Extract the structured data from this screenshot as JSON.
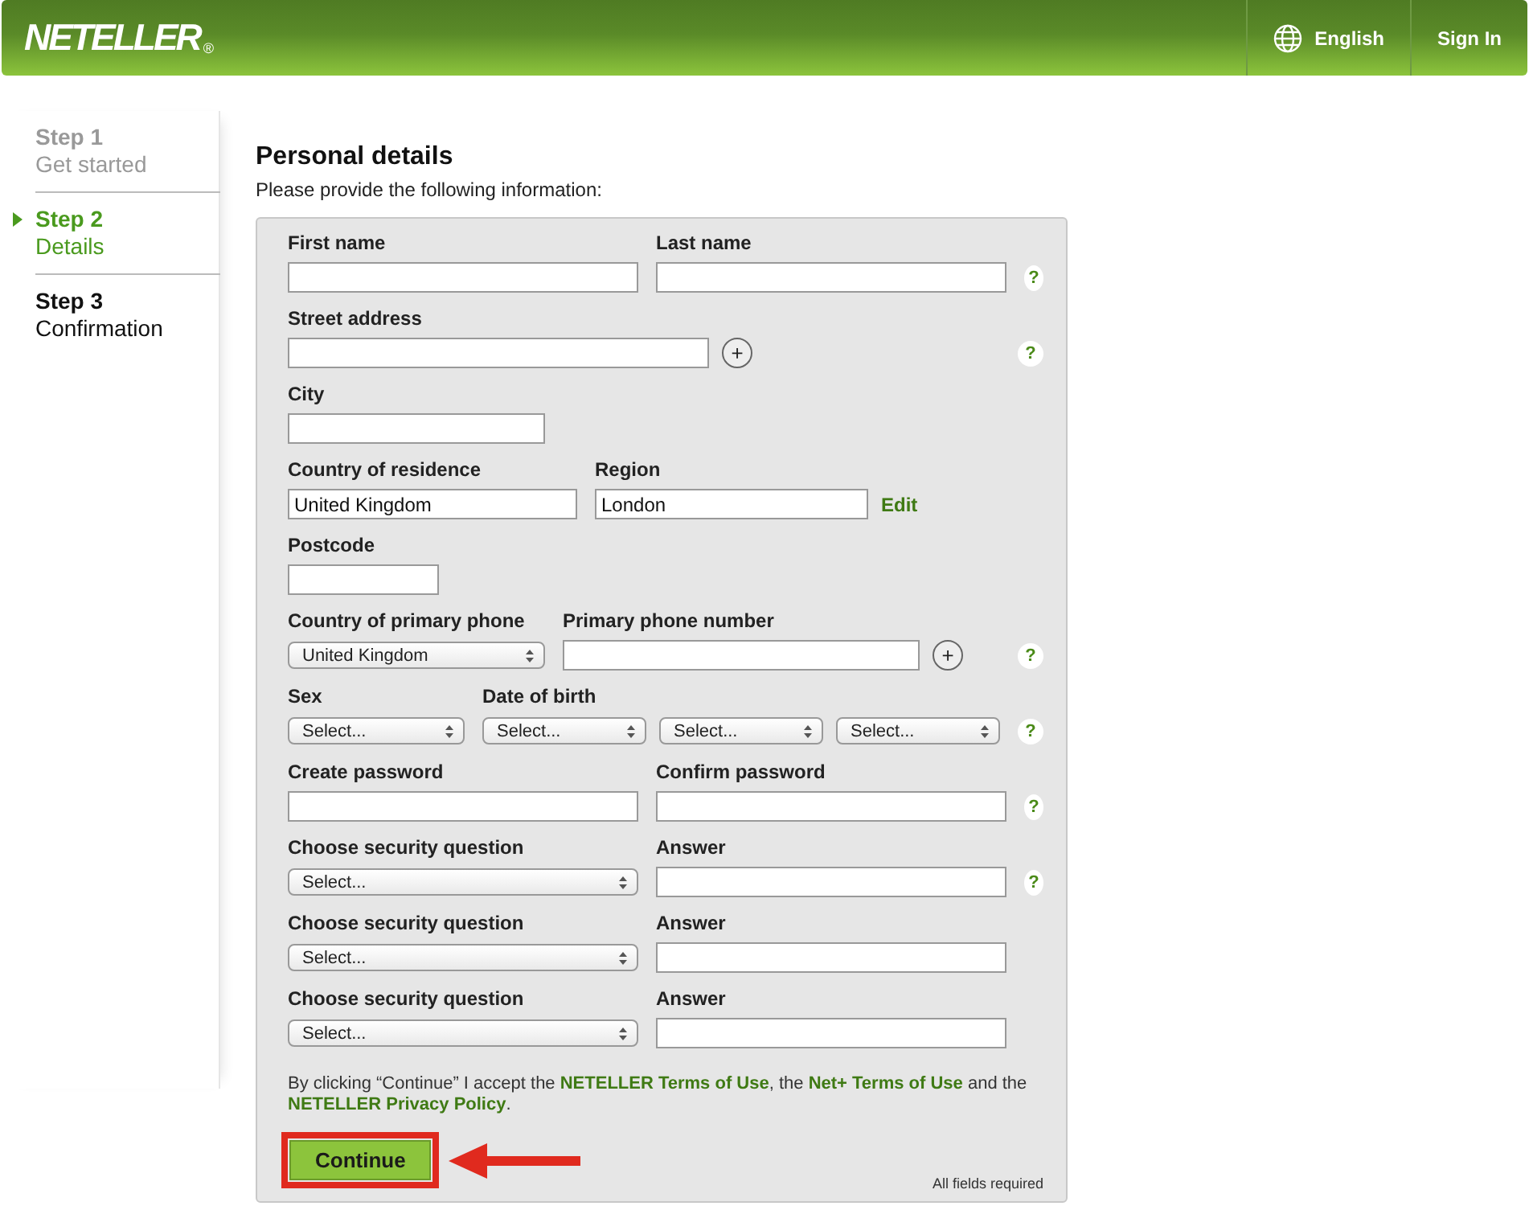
{
  "header": {
    "logo": "NETELLER",
    "logo_mark": "®",
    "language": "English",
    "sign_in": "Sign In"
  },
  "steps": [
    {
      "number": "Step 1",
      "name": "Get started",
      "completed": true,
      "selected": false
    },
    {
      "number": "Step 2",
      "name": "Details",
      "completed": false,
      "selected": true
    },
    {
      "number": "Step 3",
      "name": "Confirmation",
      "completed": false,
      "selected": false
    }
  ],
  "title": "Personal details",
  "intro": "Please provide the following information:",
  "rows": [
    {
      "help": true,
      "groups": [
        {
          "label": "First name",
          "controls": [
            {
              "kind": "text"
            }
          ]
        },
        {
          "label": "Last name",
          "controls": [
            {
              "kind": "text"
            }
          ]
        }
      ]
    },
    {
      "help": true,
      "groups": [
        {
          "label": "Street address",
          "controls": [
            {
              "kind": "text"
            },
            {
              "kind": "plus",
              "text": "+"
            }
          ]
        }
      ]
    },
    {
      "help": false,
      "groups": [
        {
          "label": "City",
          "controls": [
            {
              "kind": "text"
            }
          ]
        }
      ]
    },
    {
      "help": false,
      "groups": [
        {
          "label": "Country of residence",
          "controls": [
            {
              "kind": "text",
              "value": "United Kingdom"
            }
          ]
        },
        {
          "label": "Region",
          "controls": [
            {
              "kind": "text",
              "value": "London"
            },
            {
              "kind": "link",
              "text": "Edit"
            }
          ]
        }
      ]
    },
    {
      "help": false,
      "groups": [
        {
          "label": "Postcode",
          "controls": [
            {
              "kind": "text"
            }
          ]
        }
      ]
    },
    {
      "help": true,
      "groups": [
        {
          "label": "Country of primary phone",
          "controls": [
            {
              "kind": "select",
              "value": "United Kingdom"
            }
          ]
        },
        {
          "label": "Primary phone number",
          "controls": [
            {
              "kind": "text"
            },
            {
              "kind": "plus",
              "text": "+"
            }
          ]
        }
      ]
    },
    {
      "help": true,
      "groups": [
        {
          "label": "Sex",
          "controls": [
            {
              "kind": "select",
              "value": "Select..."
            }
          ]
        },
        {
          "label": "Date of birth",
          "controls": [
            {
              "kind": "select",
              "value": "Select..."
            },
            {
              "kind": "select",
              "value": "Select..."
            },
            {
              "kind": "select",
              "value": "Select..."
            }
          ]
        }
      ]
    },
    {
      "help": true,
      "groups": [
        {
          "label": "Create password",
          "controls": [
            {
              "kind": "text"
            }
          ]
        },
        {
          "label": "Confirm password",
          "controls": [
            {
              "kind": "text"
            }
          ]
        }
      ]
    },
    {
      "help": true,
      "groups": [
        {
          "label": "Choose security question",
          "controls": [
            {
              "kind": "select",
              "value": "Select..."
            }
          ]
        },
        {
          "label": "Answer",
          "controls": [
            {
              "kind": "text"
            }
          ]
        }
      ]
    },
    {
      "help": false,
      "groups": [
        {
          "label": "Choose security question",
          "controls": [
            {
              "kind": "select",
              "value": "Select..."
            }
          ]
        },
        {
          "label": "Answer",
          "controls": [
            {
              "kind": "text"
            }
          ]
        }
      ]
    },
    {
      "help": false,
      "groups": [
        {
          "label": "Choose security question",
          "controls": [
            {
              "kind": "select",
              "value": "Select..."
            }
          ]
        },
        {
          "label": "Answer",
          "controls": [
            {
              "kind": "text"
            }
          ]
        }
      ]
    }
  ],
  "help_mark": "?",
  "terms": [
    {
      "kind": "text",
      "text": "By clicking “Continue” I accept the "
    },
    {
      "kind": "link",
      "text": "NETELLER Terms of Use"
    },
    {
      "kind": "text",
      "text": ", the "
    },
    {
      "kind": "link",
      "text": "Net+ Terms of Use"
    },
    {
      "kind": "text",
      "text": " and the "
    },
    {
      "kind": "link",
      "text": "NETELLER Privacy Policy"
    },
    {
      "kind": "text",
      "text": "."
    }
  ],
  "continue": "Continue",
  "required_note": "All fields required"
}
